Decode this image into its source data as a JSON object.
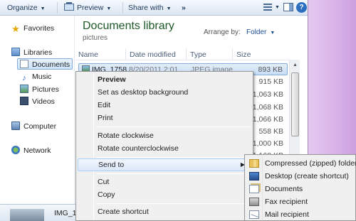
{
  "toolbar": {
    "organize": "Organize",
    "preview": "Preview",
    "share_with": "Share with",
    "more": "»"
  },
  "nav": {
    "favorites": "Favorites",
    "libraries": "Libraries",
    "documents": "Documents",
    "music": "Music",
    "pictures": "Pictures",
    "videos": "Videos",
    "computer": "Computer",
    "network": "Network"
  },
  "library": {
    "title": "Documents library",
    "subtitle": "pictures",
    "arrange_label": "Arrange by:",
    "arrange_value": "Folder"
  },
  "columns": {
    "name": "Name",
    "date_modified": "Date modified",
    "type": "Type",
    "size": "Size"
  },
  "files": [
    {
      "name": "IMG_1758",
      "date": "8/20/2011 2:01 ...",
      "type": "JPEG image",
      "size": "893 KB"
    },
    {
      "name": "",
      "date": "",
      "type": "",
      "size": "915 KB"
    },
    {
      "name": "",
      "date": "",
      "type": "",
      "size": "1,063 KB"
    },
    {
      "name": "",
      "date": "",
      "type": "",
      "size": "1,068 KB"
    },
    {
      "name": "",
      "date": "",
      "type": "",
      "size": "1,066 KB"
    },
    {
      "name": "",
      "date": "",
      "type": "",
      "size": "558 KB"
    },
    {
      "name": "",
      "date": "",
      "type": "",
      "size": "1,000 KB"
    },
    {
      "name": "",
      "date": "",
      "type": "",
      "size": "1,168 KB"
    }
  ],
  "details": {
    "name": "IMG_17"
  },
  "context_menu": {
    "preview": "Preview",
    "set_background": "Set as desktop background",
    "edit": "Edit",
    "print": "Print",
    "rotate_cw": "Rotate clockwise",
    "rotate_ccw": "Rotate counterclockwise",
    "send_to": "Send to",
    "cut": "Cut",
    "copy": "Copy",
    "create_shortcut": "Create shortcut"
  },
  "send_to_menu": {
    "zip": "Compressed (zipped) folder",
    "desktop": "Desktop (create shortcut)",
    "documents": "Documents",
    "fax": "Fax recipient",
    "mail": "Mail recipient"
  },
  "colors": {
    "library_title": "#1e5a2a",
    "selection": "#cde4fb",
    "window_frame": "#d9b2e8"
  }
}
